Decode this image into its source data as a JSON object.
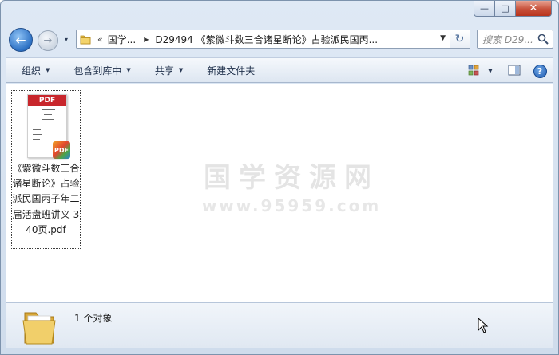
{
  "window": {
    "caption": {
      "minimize_glyph": "—",
      "maximize_glyph": "□",
      "close_glyph": "✕"
    }
  },
  "nav": {
    "back_glyph": "←",
    "forward_glyph": "→",
    "history_glyph": "▾",
    "breadcrumb": {
      "overflow": "«",
      "items": [
        "国学...",
        "D29494 《紫微斗数三合诸星断论》占验派民国丙..."
      ]
    },
    "address_drop_glyph": "▼",
    "refresh_glyph": "↻",
    "search": {
      "placeholder": "搜索 D29..."
    }
  },
  "toolbar": {
    "organize_label": "组织",
    "include_library_label": "包含到库中",
    "share_label": "共享",
    "new_folder_label": "新建文件夹",
    "help_glyph": "?"
  },
  "content": {
    "files": [
      {
        "name": "《紫微斗数三合诸星断论》占验派民国丙子年二届活盘班讲义 340页.pdf",
        "thumb_header": "PDF",
        "badge": "PDF"
      }
    ],
    "watermark": {
      "title": "国学资源网",
      "url": "www.95959.com"
    }
  },
  "details": {
    "count_label": "1 个对象"
  },
  "colors": {
    "accent": "#2d71c4",
    "close": "#c7503a",
    "pdf_red": "#c8262c"
  }
}
